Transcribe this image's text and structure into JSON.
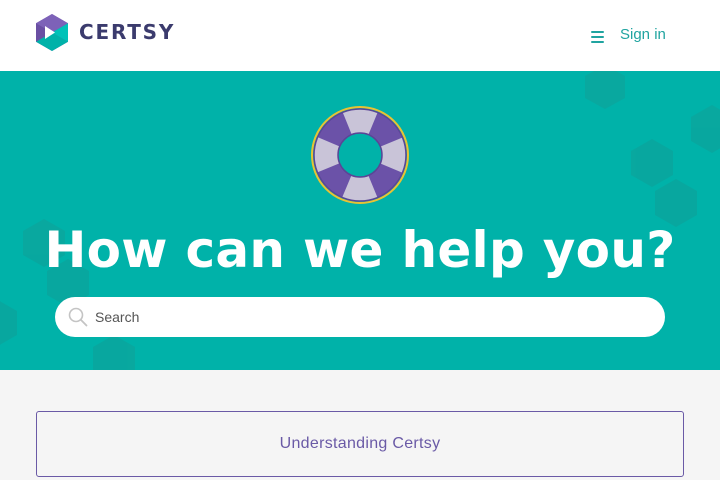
{
  "header": {
    "brand": "CERTSY",
    "signin_label": "Sign in"
  },
  "hero": {
    "title": "How can we help you?",
    "search_placeholder": "Search"
  },
  "categories": [
    {
      "label": "Understanding Certsy"
    }
  ],
  "colors": {
    "teal": "#00b2a9",
    "brand_purple": "#3b3b6d",
    "link_teal": "#20a4a0",
    "card_purple": "#6a5aa6"
  },
  "icons": {
    "logo": "certsy-logo-icon",
    "menu": "hamburger-menu-icon",
    "hero": "lifebuoy-icon",
    "search": "search-icon"
  }
}
